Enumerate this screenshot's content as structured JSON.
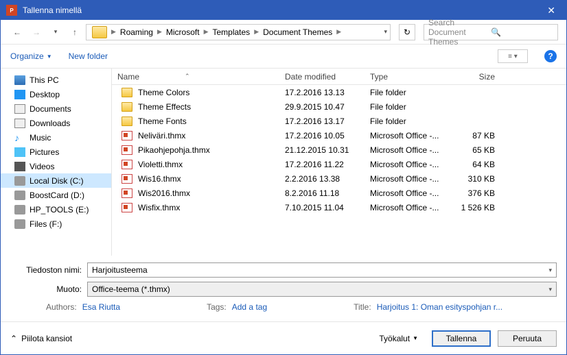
{
  "window": {
    "title": "Tallenna nimellä"
  },
  "breadcrumb": [
    "Roaming",
    "Microsoft",
    "Templates",
    "Document Themes"
  ],
  "search": {
    "placeholder": "Search Document Themes"
  },
  "toolbar": {
    "organize": "Organize",
    "newfolder": "New folder"
  },
  "columns": {
    "name": "Name",
    "date": "Date modified",
    "type": "Type",
    "size": "Size"
  },
  "sidebar": [
    {
      "label": "This PC",
      "icon": "pc"
    },
    {
      "label": "Desktop",
      "icon": "desktop"
    },
    {
      "label": "Documents",
      "icon": "doc"
    },
    {
      "label": "Downloads",
      "icon": "down"
    },
    {
      "label": "Music",
      "icon": "music"
    },
    {
      "label": "Pictures",
      "icon": "pic"
    },
    {
      "label": "Videos",
      "icon": "vid"
    },
    {
      "label": "Local Disk (C:)",
      "icon": "disk",
      "selected": true
    },
    {
      "label": "BoostCard (D:)",
      "icon": "disk"
    },
    {
      "label": "HP_TOOLS (E:)",
      "icon": "disk"
    },
    {
      "label": "Files (F:)",
      "icon": "disk"
    }
  ],
  "files": [
    {
      "name": "Theme Colors",
      "date": "17.2.2016 13.13",
      "type": "File folder",
      "size": "",
      "icon": "folder"
    },
    {
      "name": "Theme Effects",
      "date": "29.9.2015 10.47",
      "type": "File folder",
      "size": "",
      "icon": "folder"
    },
    {
      "name": "Theme Fonts",
      "date": "17.2.2016 13.17",
      "type": "File folder",
      "size": "",
      "icon": "folder"
    },
    {
      "name": "Neliväri.thmx",
      "date": "17.2.2016 10.05",
      "type": "Microsoft Office -...",
      "size": "87 KB",
      "icon": "thmx"
    },
    {
      "name": "Pikaohjepohja.thmx",
      "date": "21.12.2015 10.31",
      "type": "Microsoft Office -...",
      "size": "65 KB",
      "icon": "thmx"
    },
    {
      "name": "Violetti.thmx",
      "date": "17.2.2016 11.22",
      "type": "Microsoft Office -...",
      "size": "64 KB",
      "icon": "thmx"
    },
    {
      "name": "Wis16.thmx",
      "date": "2.2.2016 13.38",
      "type": "Microsoft Office -...",
      "size": "310 KB",
      "icon": "thmx"
    },
    {
      "name": "Wis2016.thmx",
      "date": "8.2.2016 11.18",
      "type": "Microsoft Office -...",
      "size": "376 KB",
      "icon": "thmx"
    },
    {
      "name": "Wisfix.thmx",
      "date": "7.10.2015 11.04",
      "type": "Microsoft Office -...",
      "size": "1 526 KB",
      "icon": "thmx"
    }
  ],
  "filename": {
    "label": "Tiedoston nimi:",
    "value": "Harjoitusteema"
  },
  "filetype": {
    "label": "Muoto:",
    "value": "Office-teema (*.thmx)"
  },
  "meta": {
    "authors_label": "Authors:",
    "authors": "Esa Riutta",
    "tags_label": "Tags:",
    "tags": "Add a tag",
    "title_label": "Title:",
    "title": "Harjoitus 1: Oman esityspohjan r..."
  },
  "bottom": {
    "hide": "Piilota kansiot",
    "tools": "Työkalut",
    "save": "Tallenna",
    "cancel": "Peruuta"
  }
}
